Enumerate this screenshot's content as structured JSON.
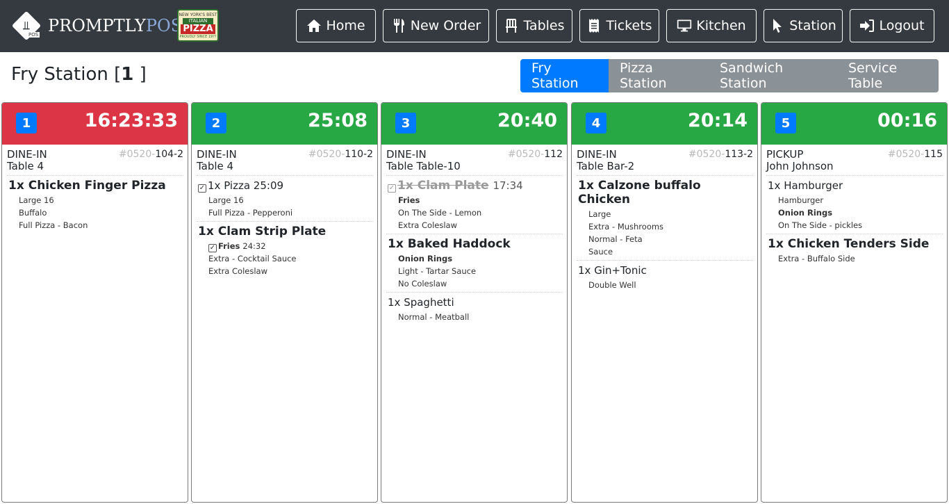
{
  "brand": {
    "name_part1": "PROMPTLY",
    "name_part2": "POS",
    "pos_tag": "POS"
  },
  "partner_logo": {
    "line1": "NEW YORK'S BEST",
    "line2": "ITALIAN",
    "line3": "PIZZA",
    "line4": "PROUDLY SINCE 19??"
  },
  "nav": [
    {
      "label": "Home",
      "icon": "home-icon"
    },
    {
      "label": "New Order",
      "icon": "utensils-icon"
    },
    {
      "label": "Tables",
      "icon": "chair-icon"
    },
    {
      "label": "Tickets",
      "icon": "receipt-icon"
    },
    {
      "label": "Kitchen",
      "icon": "monitor-icon"
    },
    {
      "label": "Station",
      "icon": "pointer-icon"
    },
    {
      "label": "Logout",
      "icon": "logout-icon"
    }
  ],
  "page": {
    "title_prefix": "Fry Station [",
    "title_count": "1",
    "title_suffix": " ]"
  },
  "station_tabs": [
    {
      "label": "Fry Station",
      "active": true
    },
    {
      "label": "Pizza Station",
      "active": false
    },
    {
      "label": "Sandwich Station",
      "active": false
    },
    {
      "label": "Service Table",
      "active": false
    }
  ],
  "tickets": [
    {
      "number": "1",
      "time": "16:23:33",
      "status_color": "#dc3545",
      "type": "DINE-IN",
      "location": "Table 4",
      "order_prefix": "#0520-",
      "order_suffix": "104-2",
      "items": [
        {
          "name": "1x Chicken Finger Pizza",
          "mods": [
            "Large 16",
            "Buffalo",
            "Full Pizza - Bacon"
          ]
        }
      ]
    },
    {
      "number": "2",
      "time": "25:08",
      "status_color": "#28a745",
      "type": "DINE-IN",
      "location": "Table 4",
      "order_prefix": "#0520-",
      "order_suffix": "110-2",
      "items": [
        {
          "name": "1x Pizza",
          "time": "25:09",
          "mods": [
            "Large 16",
            "Full Pizza - Pepperoni"
          ]
        },
        {
          "name": "1x Clam Strip Plate",
          "mods_special": {
            "label": "Fries",
            "time": "24:32"
          },
          "mods": [
            "Extra - Cocktail Sauce",
            "Extra Coleslaw"
          ]
        }
      ]
    },
    {
      "number": "3",
      "time": "20:40",
      "status_color": "#28a745",
      "type": "DINE-IN",
      "location": "Table Table-10",
      "order_prefix": "#0520-",
      "order_suffix": "112",
      "items": [
        {
          "name": "1x Clam Plate",
          "time": "17:34",
          "bold_mod": "Fries",
          "mods": [
            "On The Side - Lemon",
            "Extra Coleslaw"
          ]
        },
        {
          "name": "1x Baked Haddock",
          "bold_mod": "Onion Rings",
          "mods": [
            "Light - Tartar Sauce",
            "No Coleslaw"
          ]
        },
        {
          "name": "1x Spaghetti",
          "mods": [
            "Normal - Meatball"
          ]
        }
      ]
    },
    {
      "number": "4",
      "time": "20:14",
      "status_color": "#28a745",
      "type": "DINE-IN",
      "location": "Table Bar-2",
      "order_prefix": "#0520-",
      "order_suffix": "113-2",
      "items": [
        {
          "name": "1x Calzone buffalo Chicken",
          "mods": [
            "Large",
            "Extra - Mushrooms",
            "Normal - Feta",
            "Sauce"
          ]
        },
        {
          "name": "1x Gin+Tonic",
          "mods": [
            "Double Well"
          ]
        }
      ]
    },
    {
      "number": "5",
      "time": "00:16",
      "status_color": "#28a745",
      "type": "PICKUP",
      "location": "John Johnson",
      "order_prefix": "#0520-",
      "order_suffix": "115",
      "items": [
        {
          "name": "1x Hamburger",
          "mods_a": [
            "Hamburger"
          ],
          "bold_mod": "Onion Rings",
          "mods": [
            "On The Side - pickles"
          ]
        },
        {
          "name": "1x Chicken Tenders Side",
          "mods": [
            "Extra - Buffalo Side"
          ]
        }
      ]
    }
  ]
}
